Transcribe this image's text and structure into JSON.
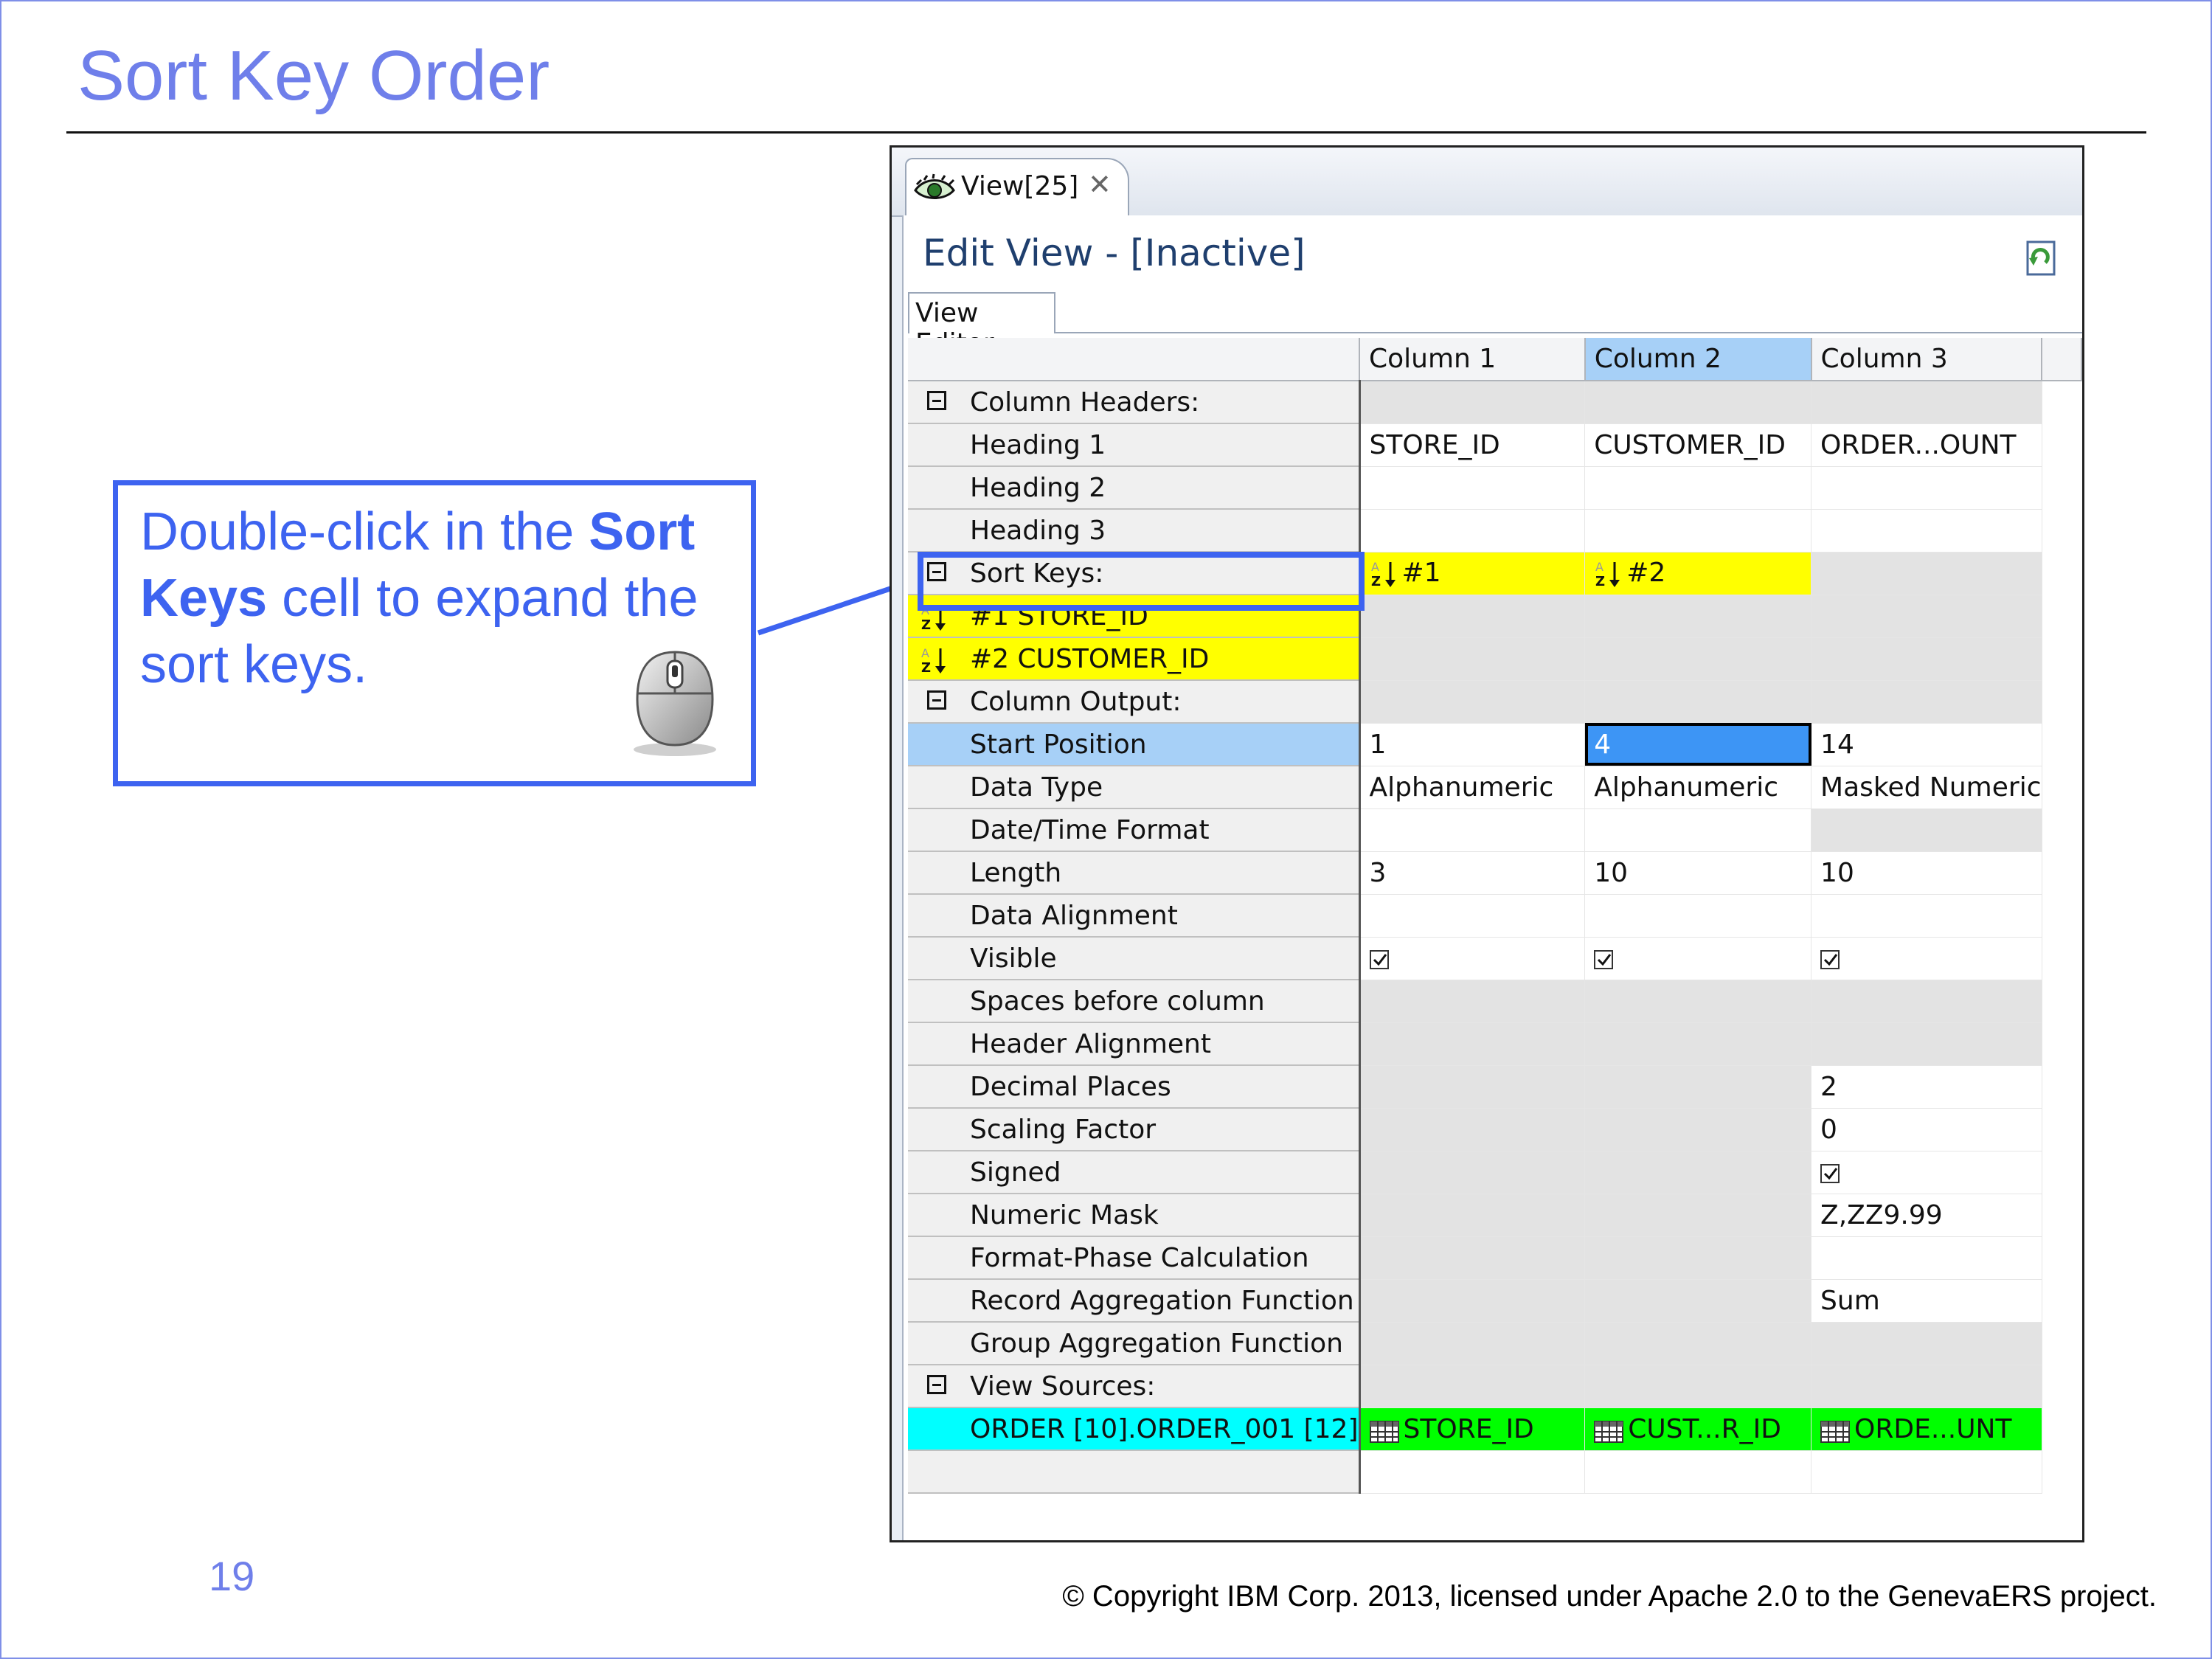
{
  "slide": {
    "title": "Sort Key Order",
    "page_number": "19",
    "copyright": "© Copyright IBM Corp. 2013, licensed under Apache 2.0 to the GenevaERS project."
  },
  "callout": {
    "text_1": "Double-click in the ",
    "bold_1": "Sort Keys",
    "text_2": " cell to expand the sort keys.",
    "icon": "mouse-icon"
  },
  "window": {
    "tab_label": "View[25]",
    "tab_close": "✕",
    "editor_title": "Edit View - [Inactive]",
    "editor_tab": "View Editor"
  },
  "grid": {
    "columns": [
      "Column 1",
      "Column 2",
      "Column 3"
    ],
    "selected_column": "Column 2",
    "rows": [
      {
        "label": "Column Headers:",
        "kind": "group",
        "cells": [
          "",
          "",
          ""
        ],
        "fills": [
          "gray",
          "gray",
          "gray"
        ]
      },
      {
        "label": "Heading 1",
        "cells": [
          "STORE_ID",
          "CUSTOMER_ID",
          "ORDER...OUNT"
        ],
        "fills": [
          "",
          "",
          ""
        ]
      },
      {
        "label": "Heading 2",
        "cells": [
          "",
          "",
          ""
        ],
        "fills": [
          "",
          "",
          ""
        ]
      },
      {
        "label": "Heading 3",
        "cells": [
          "",
          "",
          ""
        ],
        "fills": [
          "",
          "",
          ""
        ]
      },
      {
        "label": "Sort Keys:",
        "kind": "sortgroup",
        "cells": [
          "#1",
          "#2",
          ""
        ],
        "fills": [
          "yellow",
          "yellow",
          "gray"
        ]
      },
      {
        "label": "#1 STORE_ID",
        "kind": "sortsub",
        "cells": [
          "",
          "",
          ""
        ],
        "fills": [
          "gray",
          "gray",
          "gray"
        ]
      },
      {
        "label": "#2 CUSTOMER_ID",
        "kind": "sortsub",
        "cells": [
          "",
          "",
          ""
        ],
        "fills": [
          "gray",
          "gray",
          "gray"
        ]
      },
      {
        "label": "Column Output:",
        "kind": "group",
        "cells": [
          "",
          "",
          ""
        ],
        "fills": [
          "gray",
          "gray",
          "gray"
        ]
      },
      {
        "label": "Start Position",
        "kind": "startsel",
        "cells": [
          "1",
          "4",
          "14"
        ],
        "fills": [
          "",
          "active",
          ""
        ]
      },
      {
        "label": "Data Type",
        "cells": [
          "Alphanumeric",
          "Alphanumeric",
          "Masked Numeric"
        ],
        "fills": [
          "",
          "",
          ""
        ]
      },
      {
        "label": "Date/Time Format",
        "cells": [
          "",
          "",
          ""
        ],
        "fills": [
          "",
          "",
          "gray"
        ]
      },
      {
        "label": "Length",
        "cells": [
          "3",
          "10",
          "10"
        ],
        "fills": [
          "",
          "",
          ""
        ]
      },
      {
        "label": "Data Alignment",
        "cells": [
          "",
          "",
          ""
        ],
        "fills": [
          "",
          "",
          ""
        ]
      },
      {
        "label": "Visible",
        "cells": [
          "check",
          "check",
          "check"
        ],
        "fills": [
          "",
          "",
          ""
        ]
      },
      {
        "label": "Spaces before column",
        "cells": [
          "",
          "",
          ""
        ],
        "fills": [
          "gray",
          "gray",
          "gray"
        ]
      },
      {
        "label": "Header Alignment",
        "cells": [
          "",
          "",
          ""
        ],
        "fills": [
          "gray",
          "gray",
          "gray"
        ]
      },
      {
        "label": "Decimal Places",
        "cells": [
          "",
          "",
          "2"
        ],
        "fills": [
          "gray",
          "gray",
          ""
        ]
      },
      {
        "label": "Scaling Factor",
        "cells": [
          "",
          "",
          "0"
        ],
        "fills": [
          "gray",
          "gray",
          ""
        ]
      },
      {
        "label": "Signed",
        "cells": [
          "",
          "",
          "check"
        ],
        "fills": [
          "gray",
          "gray",
          ""
        ]
      },
      {
        "label": "Numeric Mask",
        "cells": [
          "",
          "",
          "Z,ZZ9.99"
        ],
        "fills": [
          "gray",
          "gray",
          ""
        ]
      },
      {
        "label": "Format-Phase Calculation",
        "cells": [
          "",
          "",
          ""
        ],
        "fills": [
          "gray",
          "gray",
          ""
        ]
      },
      {
        "label": "Record Aggregation Function",
        "cells": [
          "",
          "",
          "Sum"
        ],
        "fills": [
          "gray",
          "gray",
          ""
        ]
      },
      {
        "label": "Group Aggregation Function",
        "cells": [
          "",
          "",
          ""
        ],
        "fills": [
          "gray",
          "gray",
          "gray"
        ]
      },
      {
        "label": "View Sources:",
        "kind": "group",
        "cells": [
          "",
          "",
          ""
        ],
        "fills": [
          "gray",
          "gray",
          "gray"
        ]
      },
      {
        "label": "ORDER [10].ORDER_001 [12]",
        "kind": "cyan",
        "cells": [
          "STORE_ID",
          "CUST...R_ID",
          "ORDE...UNT"
        ],
        "fills": [
          "green",
          "green",
          "green"
        ],
        "cell_icon": "table-icon"
      },
      {
        "label": "",
        "cells": [
          "",
          "",
          ""
        ],
        "fills": [
          "",
          "",
          ""
        ]
      }
    ]
  },
  "colors": {
    "title": "#6f7fea",
    "callout_border": "#3d63f0",
    "sort_yellow": "#ffff00",
    "source_cyan": "#00ffff",
    "source_green": "#00ff00",
    "selected_blue": "#a7d0f7",
    "active_cell": "#3d95f5"
  }
}
